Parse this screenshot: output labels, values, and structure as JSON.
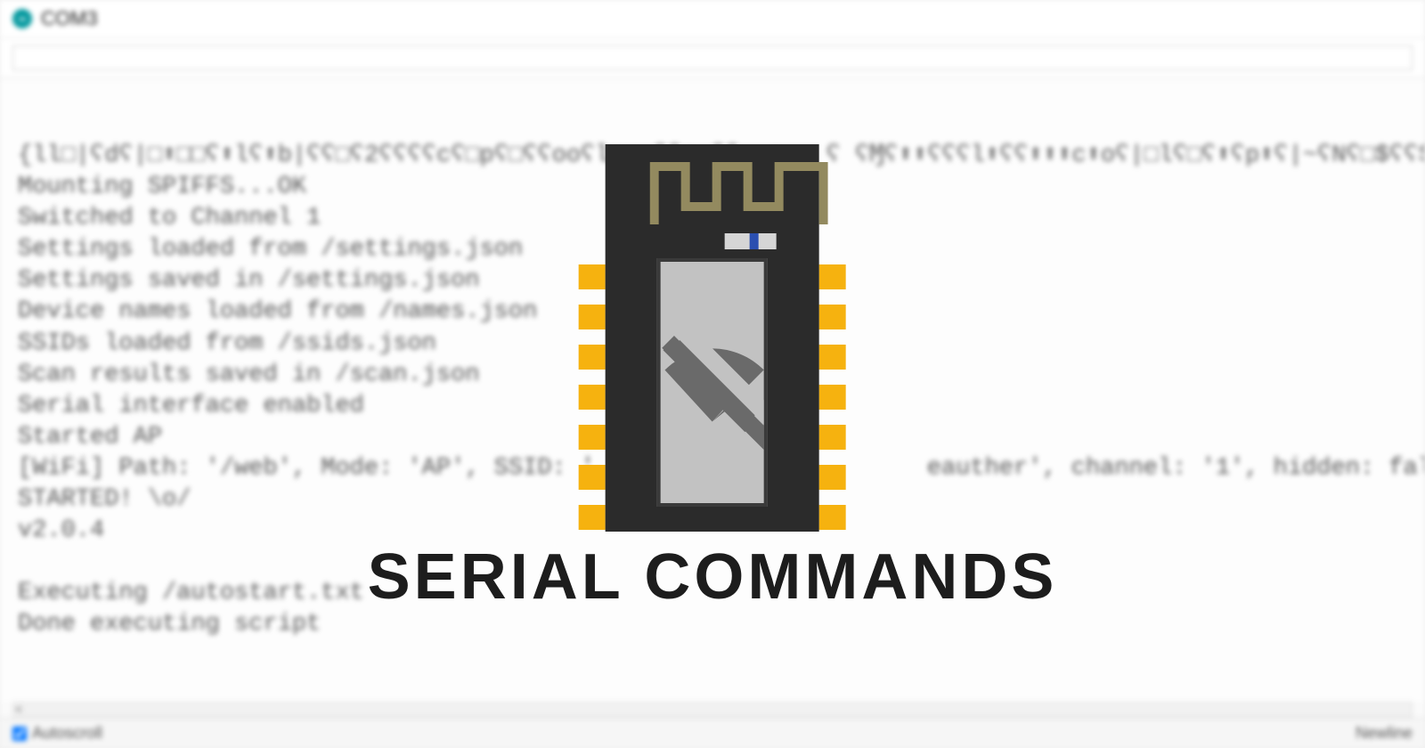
{
  "window": {
    "title": "COM3"
  },
  "input": {
    "value": ""
  },
  "console": {
    "lines": [
      "{ll□|ʕdʕ|□⬆□□ʕ⬆lʕ⬆b|ʕʕ□ʕ2ʕʕʕʕcʕ□pʕ□ʕʕooʕlnɱ ʕʕ⬆ ʕʕ  ⬆   ʕ ʕⱮʕ⬆⬆ʕʕʕl⬆ʕʕ⬆⬆⬆c⬆oʕ|□lʕ□ʕ⬆ʕp⬆ʕ|~ʕNʕ□$ʕʕ$ □",
      "Mounting SPIFFS...OK",
      "Switched to Channel 1",
      "Settings loaded from /settings.json",
      "Settings saved in /settings.json",
      "Device names loaded from /names.json",
      "SSIDs loaded from /ssids.json",
      "Scan results saved in /scan.json",
      "Serial interface enabled",
      "Started AP",
      "[WiFi] Path: '/web', Mode: 'AP', SSID: '                       eauther', channel: '1', hidden: false, ca",
      "STARTED! \\o/",
      "v2.0.4",
      "",
      "Executing /autostart.txt",
      "Done executing script"
    ]
  },
  "footer": {
    "autoscroll_label": "Autoscroll",
    "autoscroll_checked": true,
    "newline_label": "Newline"
  },
  "overlay": {
    "headline": "SERIAL COMMANDS"
  }
}
